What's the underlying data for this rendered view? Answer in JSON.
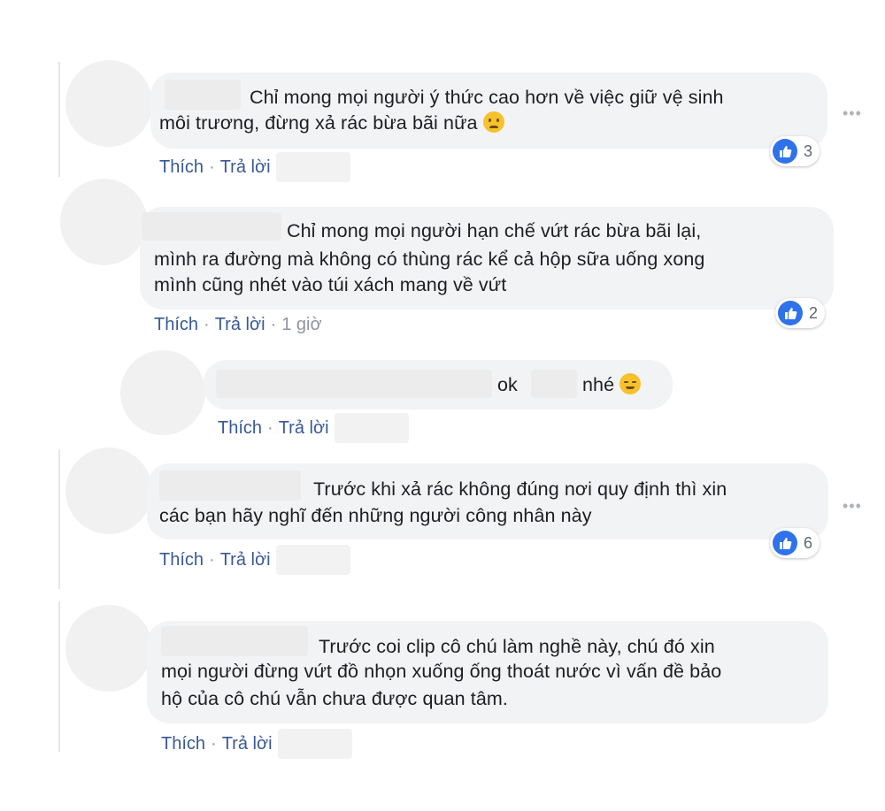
{
  "actions": {
    "like": "Thích",
    "reply": "Trả lời",
    "separator": "·"
  },
  "more_icon": "more-horizontal-icon",
  "like_icon_color": "#2f72ea",
  "link_color": "#385898",
  "comments": [
    {
      "lines": [
        "Chỉ mong mọi người ý thức cao hơn về việc giữ vệ sinh",
        "môi trương, đừng xả rác bừa bãi nữa"
      ],
      "emoji": "frowning-face-emoji",
      "reaction_count": "3"
    },
    {
      "lines": [
        "Chỉ mong mọi người hạn chế vứt rác bừa bãi lại,",
        "mình ra đường mà không có thùng rác kể cả hộp sữa uống xong",
        "mình cũng nhét vào túi xách mang về vứt"
      ],
      "time": "1 giờ",
      "reaction_count": "2"
    },
    {
      "reply": true,
      "text_a": "ok",
      "text_b": "nhé",
      "emoji": "relieved-face-emoji"
    },
    {
      "lines": [
        "Trước khi xả rác không đúng nơi quy định thì xin",
        "các bạn hãy nghĩ đến những người công nhân này"
      ],
      "reaction_count": "6"
    },
    {
      "lines": [
        "Trước coi clip cô chú làm nghề này, chú đó xin",
        "mọi người đừng vứt đồ nhọn xuống ống thoát nước vì vấn đề bảo",
        "hộ của cô chú vẫn chưa được quan tâm."
      ]
    }
  ]
}
